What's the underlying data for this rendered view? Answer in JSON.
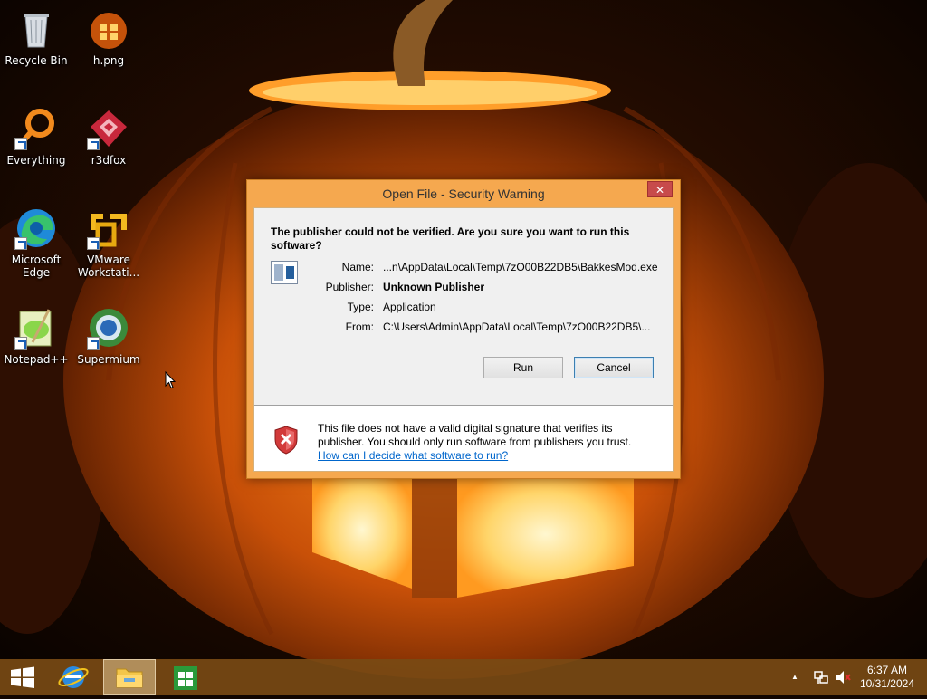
{
  "desktop": {
    "icons": [
      {
        "label": "Recycle Bin",
        "icon": "recycle-bin-icon"
      },
      {
        "label": "h.png",
        "icon": "image-file-icon"
      },
      {
        "label": "Everything",
        "icon": "everything-search-icon"
      },
      {
        "label": "r3dfox",
        "icon": "r3dfox-browser-icon"
      },
      {
        "label": "Microsoft Edge",
        "icon": "edge-browser-icon"
      },
      {
        "label": "VMware Workstati...",
        "icon": "vmware-icon"
      },
      {
        "label": "Notepad++",
        "icon": "notepad-plus-plus-icon"
      },
      {
        "label": "Supermium",
        "icon": "supermium-browser-icon"
      }
    ]
  },
  "dialog": {
    "title": "Open File - Security Warning",
    "close_label": "✕",
    "question": "The publisher could not be verified.  Are you sure you want to run this software?",
    "fields": {
      "name_label": "Name:",
      "name_value": "...n\\AppData\\Local\\Temp\\7zO00B22DB5\\BakkesMod.exe",
      "publisher_label": "Publisher:",
      "publisher_value": "Unknown Publisher",
      "type_label": "Type:",
      "type_value": "Application",
      "from_label": "From:",
      "from_value": "C:\\Users\\Admin\\AppData\\Local\\Temp\\7zO00B22DB5\\..."
    },
    "run_label": "Run",
    "cancel_label": "Cancel",
    "warning_text": "This file does not have a valid digital signature that verifies its publisher.  You should only run software from publishers you trust.",
    "help_link": "How can I decide what software to run?"
  },
  "taskbar": {
    "clock_time": "6:37 AM",
    "clock_date": "10/31/2024",
    "tray_chevron": "▲"
  },
  "colors": {
    "dialog_frame": "#f5a84f",
    "taskbar": "#784a14",
    "link": "#0066cc"
  }
}
